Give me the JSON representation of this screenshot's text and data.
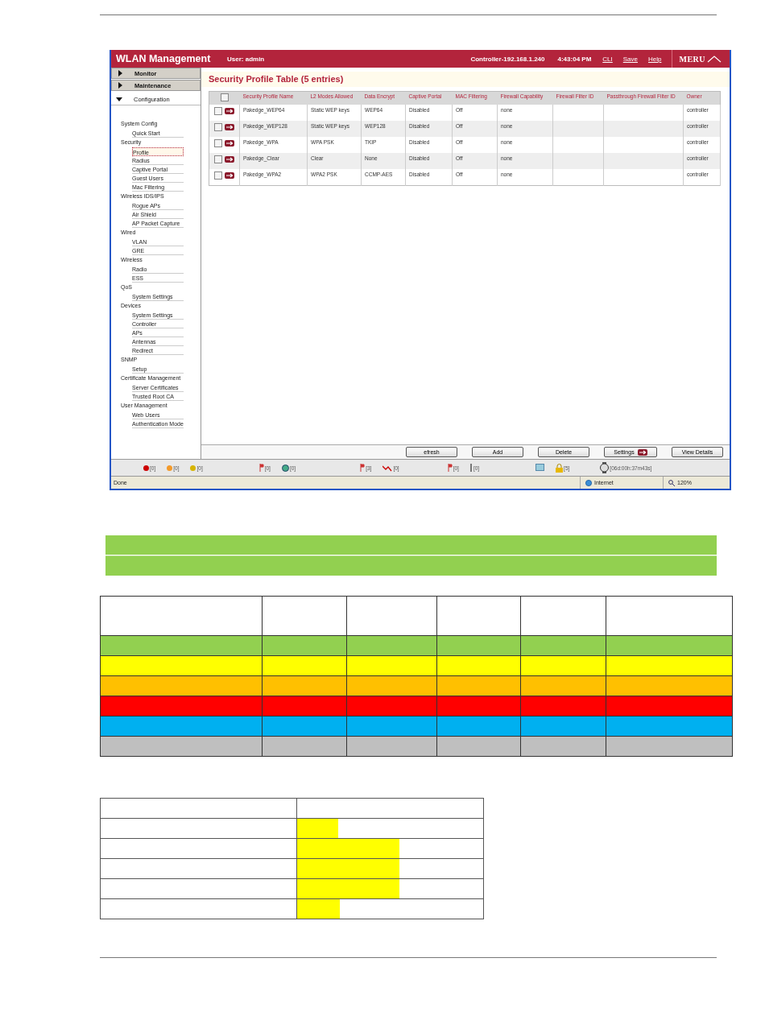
{
  "header": {
    "title": "WLAN Management",
    "user": "User: admin",
    "controller": "Controller-192.168.1.240",
    "time": "4:43:04 PM",
    "links": [
      "CLI",
      "Save",
      "Help"
    ],
    "logo": "MERU"
  },
  "nav": {
    "sections": [
      {
        "label": "Monitor",
        "expanded": false
      },
      {
        "label": "Maintenance",
        "expanded": false
      },
      {
        "label": "Configuration",
        "expanded": true
      }
    ],
    "groups": [
      {
        "label": "System Config",
        "items": [
          {
            "label": "Quick Start",
            "selected": false
          }
        ]
      },
      {
        "label": "Security",
        "items": [
          {
            "label": "Profile",
            "selected": true
          },
          {
            "label": "Radius",
            "selected": false
          },
          {
            "label": "Captive Portal",
            "selected": false
          },
          {
            "label": "Guest Users",
            "selected": false
          },
          {
            "label": "Mac Filtering",
            "selected": false
          }
        ]
      },
      {
        "label": "Wireless IDS/IPS",
        "items": [
          {
            "label": "Rogue APs",
            "selected": false
          },
          {
            "label": "Air Shield",
            "selected": false
          },
          {
            "label": "AP Packet Capture",
            "selected": false
          }
        ]
      },
      {
        "label": "Wired",
        "items": [
          {
            "label": "VLAN",
            "selected": false
          },
          {
            "label": "GRE",
            "selected": false
          }
        ]
      },
      {
        "label": "Wireless",
        "items": [
          {
            "label": "Radio",
            "selected": false
          },
          {
            "label": "ESS",
            "selected": false
          }
        ]
      },
      {
        "label": "QoS",
        "items": [
          {
            "label": "System Settings",
            "selected": false
          }
        ]
      },
      {
        "label": "Devices",
        "items": [
          {
            "label": "System Settings",
            "selected": false
          },
          {
            "label": "Controller",
            "selected": false
          },
          {
            "label": "APs",
            "selected": false
          },
          {
            "label": "Antennas",
            "selected": false
          },
          {
            "label": "Redirect",
            "selected": false
          }
        ]
      },
      {
        "label": "SNMP",
        "items": [
          {
            "label": "Setup",
            "selected": false
          }
        ]
      },
      {
        "label": "Certificate Management",
        "items": [
          {
            "label": "Server Certificates",
            "selected": false
          },
          {
            "label": "Trusted Root CA",
            "selected": false
          }
        ]
      },
      {
        "label": "User Management",
        "items": [
          {
            "label": "Web Users",
            "selected": false
          },
          {
            "label": "Authentication Mode",
            "selected": false
          }
        ]
      }
    ]
  },
  "content": {
    "title": "Security Profile Table (5 entries)",
    "table": {
      "header_checked": false,
      "columns": [
        "Security Profile Name",
        "L2 Modes Allowed",
        "Data Encrypt",
        "Captive Portal",
        "MAC Filtering",
        "Firewall Capability",
        "Firewall Filter ID",
        "Passthrough Firewall Filter ID",
        "Owner"
      ],
      "rows": [
        {
          "checked": false,
          "cells": [
            "Pakedge_WEP64",
            "Static WEP keys",
            "WEP64",
            "Disabled",
            "Off",
            "none",
            "",
            "",
            "controller"
          ]
        },
        {
          "checked": false,
          "cells": [
            "Pakedge_WEP128",
            "Static WEP keys",
            "WEP128",
            "Disabled",
            "Off",
            "none",
            "",
            "",
            "controller"
          ]
        },
        {
          "checked": false,
          "cells": [
            "Pakedge_WPA",
            "WPA PSK",
            "TKIP",
            "Disabled",
            "Off",
            "none",
            "",
            "",
            "controller"
          ]
        },
        {
          "checked": false,
          "cells": [
            "Pakedge_Clear",
            "Clear",
            "None",
            "Disabled",
            "Off",
            "none",
            "",
            "",
            "controller"
          ]
        },
        {
          "checked": false,
          "cells": [
            "Pakedge_WPA2",
            "WPA2 PSK",
            "CCMP-AES",
            "Disabled",
            "Off",
            "none",
            "",
            "",
            "controller"
          ]
        }
      ]
    }
  },
  "buttons": [
    {
      "label": "efresh",
      "kind": "plain"
    },
    {
      "label": "Add",
      "kind": "plain"
    },
    {
      "label": "Delete",
      "kind": "plain"
    },
    {
      "label": "Settings",
      "kind": "arrow"
    },
    {
      "label": "View Details",
      "kind": "plain"
    }
  ],
  "alarms": [
    {
      "kind": "dot",
      "color": "#cc0000",
      "count": "[0]"
    },
    {
      "kind": "dot",
      "color": "#f39a2a",
      "count": "[0]"
    },
    {
      "kind": "dot",
      "color": "#d6b400",
      "count": "[0]"
    },
    {
      "kind": "flag",
      "count": "[0]"
    },
    {
      "kind": "globe",
      "count": "[0]"
    },
    {
      "kind": "flag",
      "count": "[3]"
    },
    {
      "kind": "graph",
      "count": "[0]"
    },
    {
      "kind": "flag",
      "count": "[0]"
    },
    {
      "kind": "bar",
      "count": "[0]"
    },
    {
      "kind": "screen"
    },
    {
      "kind": "lock",
      "count": "[5]"
    },
    {
      "kind": "watch",
      "count": "[06d:00h:37m43s]"
    }
  ],
  "status_bar": {
    "text": "Done",
    "zone": "Internet",
    "zoom": "120%"
  },
  "swatch_table": {
    "rows": [
      {
        "color": "#92d050"
      },
      {
        "color": "#ffff00"
      },
      {
        "color": "#ffc000"
      },
      {
        "color": "#ff0000"
      },
      {
        "color": "#00b0f0"
      },
      {
        "color": "#bfbfbf"
      }
    ]
  },
  "bar_table": {
    "rows": [
      {
        "level": 0.22
      },
      {
        "level": 0.55
      },
      {
        "level": 0.55
      },
      {
        "level": 0.55
      },
      {
        "level": 0.23
      }
    ]
  }
}
